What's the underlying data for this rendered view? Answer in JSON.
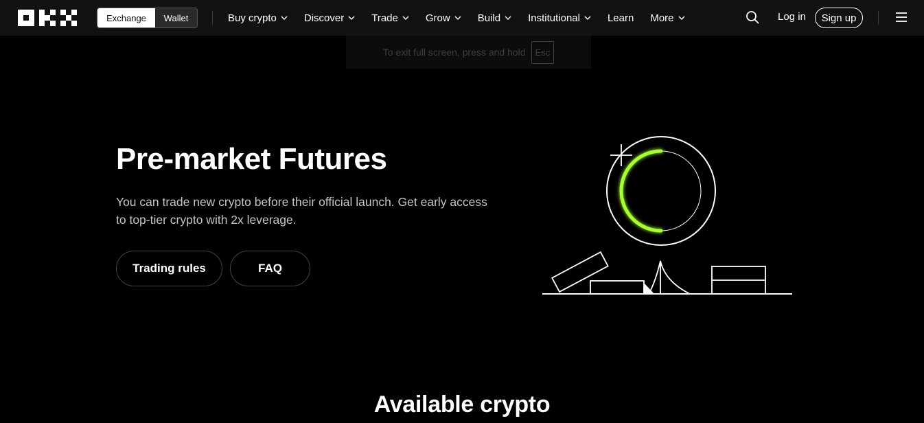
{
  "nav": {
    "logo": "OKX",
    "toggle": {
      "exchange": "Exchange",
      "wallet": "Wallet"
    },
    "menu": [
      {
        "label": "Buy crypto",
        "dropdown": true
      },
      {
        "label": "Discover",
        "dropdown": true
      },
      {
        "label": "Trade",
        "dropdown": true
      },
      {
        "label": "Grow",
        "dropdown": true
      },
      {
        "label": "Build",
        "dropdown": true
      },
      {
        "label": "Institutional",
        "dropdown": true
      },
      {
        "label": "Learn",
        "dropdown": false
      },
      {
        "label": "More",
        "dropdown": true
      }
    ],
    "login": "Log in",
    "signup": "Sign up",
    "icons": {
      "search": "search-icon",
      "menu": "hamburger-icon"
    }
  },
  "fullscreen_hint": {
    "text": "To exit full screen, press and hold",
    "key": "Esc"
  },
  "hero": {
    "title": "Pre-market Futures",
    "description": "You can trade new crypto before their official launch. Get early access to top-tier crypto with 2x leverage.",
    "buttons": {
      "rules": "Trading rules",
      "faq": "FAQ"
    },
    "accent": "#a6ff2e"
  },
  "section": {
    "title": "Available crypto"
  }
}
